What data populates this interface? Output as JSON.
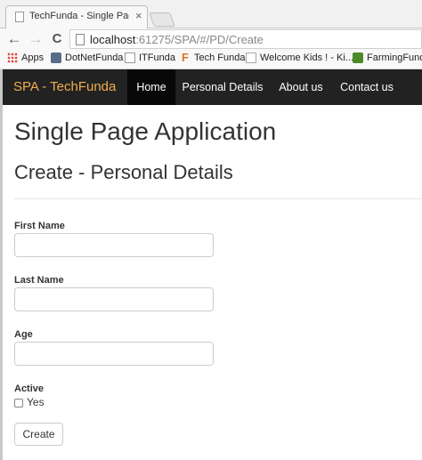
{
  "browser": {
    "tab_title": "TechFunda - Single Page A",
    "tab_close": "×",
    "url_host": "localhost",
    "url_path": ":61275/SPA/#/PD/Create",
    "back_glyph": "←",
    "forward_glyph": "→",
    "reload_glyph": "C",
    "bookmarks": [
      {
        "label": "Apps",
        "icon": "apps-grid-icon"
      },
      {
        "label": "DotNetFunda",
        "icon": "dotnetfunda-icon"
      },
      {
        "label": "ITFunda",
        "icon": "itfunda-icon"
      },
      {
        "label": "Tech Funda",
        "icon": "techfunda-icon"
      },
      {
        "label": "Welcome Kids ! - Ki...",
        "icon": "page-icon"
      },
      {
        "label": "FarmingFunda",
        "icon": "farmingfunda-icon"
      }
    ],
    "techfunda_icon_glyph": "F"
  },
  "navbar": {
    "brand": "SPA - TechFunda",
    "items": [
      {
        "label": "Home",
        "active": true
      },
      {
        "label": "Personal Details",
        "active": false
      },
      {
        "label": "About us",
        "active": false
      },
      {
        "label": "Contact us",
        "active": false
      }
    ],
    "brand_color": "#f0ad4e",
    "bg_color": "#222222"
  },
  "page": {
    "title": "Single Page Application",
    "subtitle": "Create - Personal Details",
    "form": {
      "first_name_label": "First Name",
      "first_name_value": "",
      "last_name_label": "Last Name",
      "last_name_value": "",
      "age_label": "Age",
      "age_value": "",
      "active_label": "Active",
      "active_checkbox_label": "Yes",
      "active_checked": false,
      "submit_label": "Create"
    }
  }
}
